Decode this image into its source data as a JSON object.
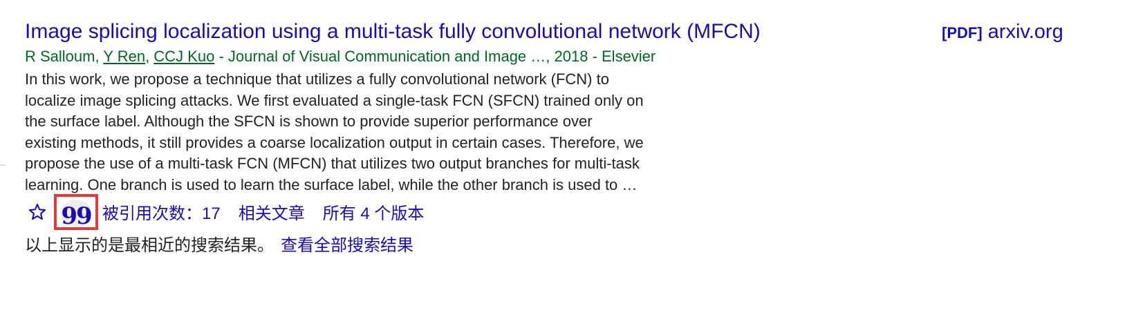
{
  "result": {
    "title": "Image splicing localization using a multi-task fully convolutional network (MFCN)",
    "side": {
      "tag": "[PDF]",
      "domain": "arxiv.org"
    },
    "authors": {
      "plain_1": "R Salloum, ",
      "link_1": "Y Ren",
      "sep": ", ",
      "link_2": "CCJ Kuo",
      "rest": " - Journal of Visual Communication and Image …, 2018 - Elsevier"
    },
    "snippet": [
      "In this work, we propose a technique that utilizes a fully convolutional network (FCN) to",
      "localize image splicing attacks. We first evaluated a single-task FCN (SFCN) trained only on",
      "the surface label. Although the SFCN is shown to provide superior performance over",
      "existing methods, it still provides a coarse localization output in certain cases. Therefore, we",
      "propose the use of a multi-task FCN (MFCN) that utilizes two output branches for multi-task",
      "learning. One branch is used to learn the surface label, while the other branch is used to …"
    ],
    "actions": {
      "star_icon": "star-outline-icon",
      "cite_icon": "quote-icon",
      "cite_glyph": "99",
      "cited_by": "被引用次数：17",
      "related": "相关文章",
      "versions": "所有 4 个版本"
    }
  },
  "footer_note": {
    "text": "以上显示的是最相近的搜索结果。",
    "link": "查看全部搜索结果"
  },
  "colors": {
    "link": "#1a0dab",
    "green": "#006621",
    "text": "#222222",
    "highlight_border": "#e53935"
  }
}
